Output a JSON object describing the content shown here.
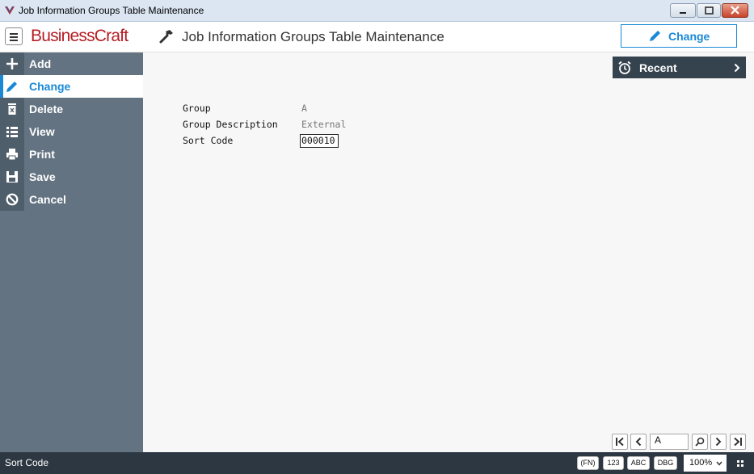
{
  "window": {
    "title": "Job Information Groups Table Maintenance"
  },
  "header": {
    "logo": "BusinessCraft",
    "page_title": "Job Information Groups Table Maintenance",
    "mode_button": "Change"
  },
  "sidebar": {
    "items": [
      {
        "label": "Add",
        "icon": "plus-icon"
      },
      {
        "label": "Change",
        "icon": "pencil-icon"
      },
      {
        "label": "Delete",
        "icon": "trash-icon"
      },
      {
        "label": "View",
        "icon": "list-icon"
      },
      {
        "label": "Print",
        "icon": "printer-icon"
      },
      {
        "label": "Save",
        "icon": "floppy-icon"
      },
      {
        "label": "Cancel",
        "icon": "cancel-icon"
      }
    ],
    "active_index": 1
  },
  "recent": {
    "label": "Recent"
  },
  "form": {
    "group_label": "Group",
    "group_value": "A",
    "description_label": "Group Description",
    "description_value": "External",
    "sort_label": "Sort Code",
    "sort_value": "000010"
  },
  "record_nav": {
    "value": "A"
  },
  "status": {
    "text": "Sort Code",
    "fn": "(FN)",
    "num": "123",
    "abc": "ABC",
    "dbg": "DBG",
    "zoom": "100%"
  },
  "colors": {
    "accent": "#1a88d6",
    "sidebar": "#637381",
    "statusbar": "#2d3741",
    "brand": "#b51d24"
  }
}
